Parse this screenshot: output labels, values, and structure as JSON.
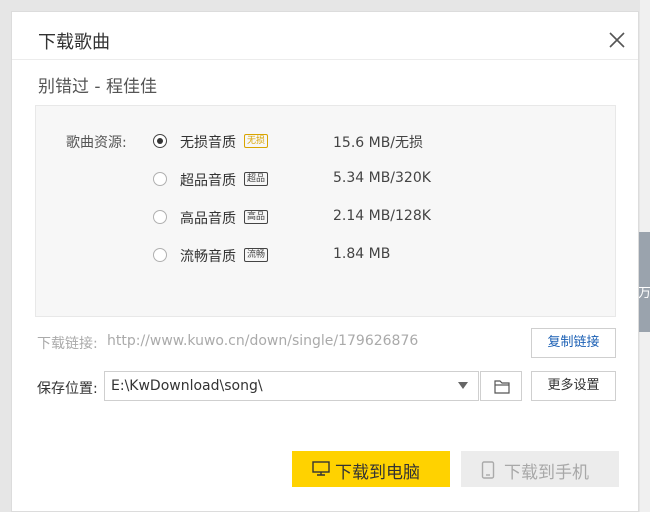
{
  "dialog": {
    "title": "下载歌曲",
    "song_title": "别错过 - 程佳佳"
  },
  "quality": {
    "label": "歌曲资源:",
    "selected_index": 0,
    "options": [
      {
        "name": "无损音质",
        "tag": "无损",
        "size": "15.6  MB/无损",
        "tag_color": "#d9a400"
      },
      {
        "name": "超品音质",
        "tag": "超品",
        "size": "5.34 MB/320K",
        "tag_color": "#444444"
      },
      {
        "name": "高品音质",
        "tag": "高品",
        "size": "2.14 MB/128K",
        "tag_color": "#444444"
      },
      {
        "name": "流畅音质",
        "tag": "流畅",
        "size": "1.84 MB",
        "tag_color": "#444444"
      }
    ]
  },
  "link": {
    "label": "下载链接:",
    "url": "http://www.kuwo.cn/down/single/179626876",
    "copy_button": "复制链接"
  },
  "save": {
    "label": "保存位置:",
    "path": "E:\\KwDownload\\song\\",
    "more_button": "更多设置"
  },
  "actions": {
    "download_pc": "下载到电脑",
    "download_phone": "下载到手机"
  },
  "colors": {
    "accent": "#ffd200",
    "link_blue": "#1a5fb4"
  },
  "background": {
    "edge_text": "万"
  }
}
